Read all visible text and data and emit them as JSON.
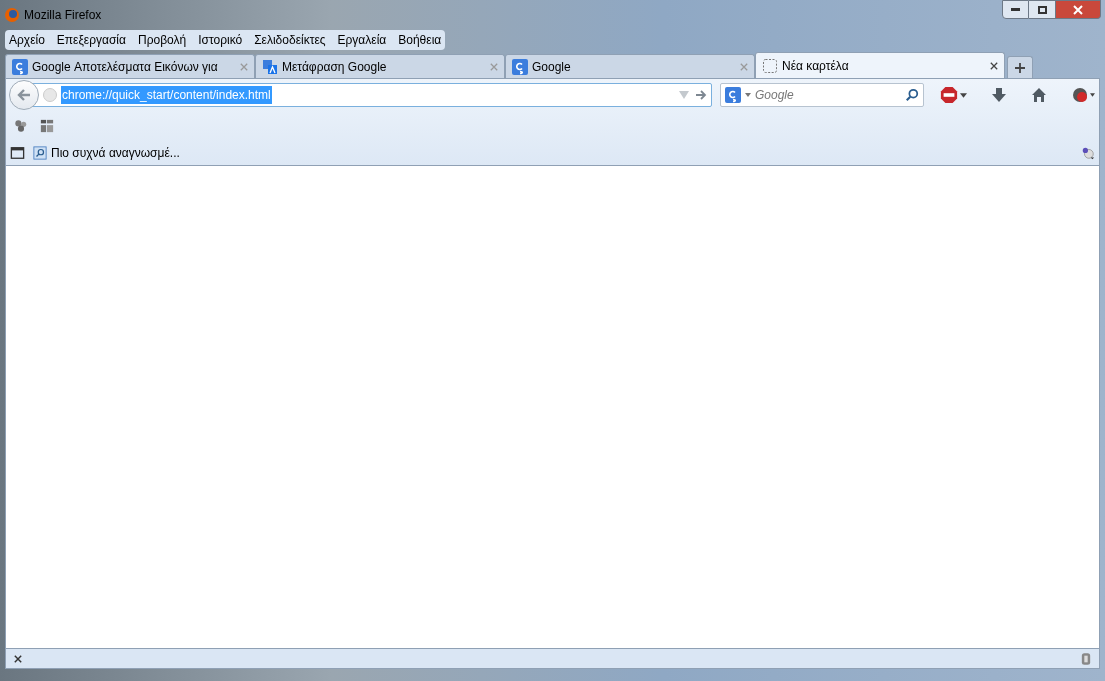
{
  "window": {
    "title": "Mozilla Firefox"
  },
  "menu": [
    "Αρχείο",
    "Επεξεργασία",
    "Προβολή",
    "Ιστορικό",
    "Σελιδοδείκτες",
    "Εργαλεία",
    "Βοήθεια"
  ],
  "tabs": [
    {
      "label": "Google Αποτελέσματα Εικόνων για",
      "kind": "google",
      "selected": false
    },
    {
      "label": "Μετάφραση Google",
      "kind": "translate",
      "selected": false
    },
    {
      "label": "Google",
      "kind": "google",
      "selected": false
    },
    {
      "label": "Νέα καρτέλα",
      "kind": "blank",
      "selected": true
    }
  ],
  "address_bar": {
    "value": "chrome://quick_start/content/index.html",
    "selected": true
  },
  "search": {
    "placeholder": "Google"
  },
  "bookmarks": [
    {
      "label": "Πιο συχνά αναγνωσμέ..."
    }
  ]
}
